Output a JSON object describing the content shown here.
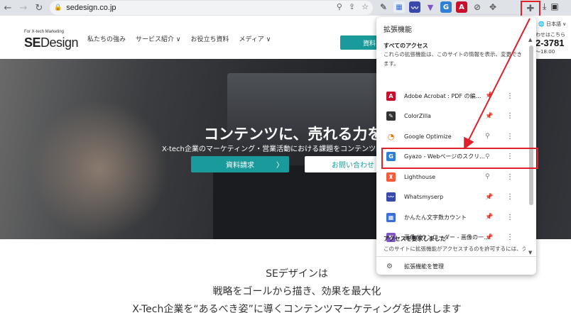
{
  "browser": {
    "url": "sedesign.co.jp",
    "toolbar_icons": [
      "eyedropper-icon",
      "ext-icon",
      "chart-icon",
      "ext-icon",
      "gyazo-icon",
      "acrobat-icon",
      "compass-icon",
      "move-icon"
    ]
  },
  "site": {
    "logo_small": "For X-tech Marketing",
    "logo_bold": "SE",
    "logo_thin": "Design",
    "nav": [
      "私たちの強み",
      "サービス紹介 ∨",
      "お役立ち資料",
      "メディア ∨"
    ],
    "cta": "資料",
    "lang": "🌐 日本語 ∨",
    "contact": "わせはこちら",
    "phone": "2-3781",
    "hours": "～18:00"
  },
  "hero": {
    "title": "コンテンツに、売れる力を",
    "subtitle": "X-tech企業のマーケティング・営業活動における課題をコンテンツ",
    "btn_primary": "資料請求",
    "btn_secondary": "お問い合わせ"
  },
  "intro": {
    "line1": "SEデザインは",
    "line2": "戦略をゴールから描き、効果を最大化",
    "line3": "X-Tech企業を“あるべき姿”に導くコンテンツマーケティングを提供します"
  },
  "popup": {
    "title": "拡張機能",
    "section_access": "すべてのアクセス",
    "access_desc": "これらの拡張機能は、このサイトの情報を表示、変更でき ます。",
    "extensions": [
      {
        "name": "Adobe Acrobat : PDF の編...",
        "color": "#c8102e",
        "glyph": "A",
        "pinned": true
      },
      {
        "name": "ColorZilla",
        "color": "#333333",
        "glyph": "✎",
        "pinned": true
      },
      {
        "name": "Google Optimize",
        "color": "#ffffff",
        "glyph": "◔",
        "pinned": false
      },
      {
        "name": "Gyazo - Webページのスクリ...",
        "color": "#2f7fd6",
        "glyph": "G",
        "pinned": false
      },
      {
        "name": "Lighthouse",
        "color": "#f25c3b",
        "glyph": "♜",
        "pinned": false
      },
      {
        "name": "Whatsmyserp",
        "color": "#3949ab",
        "glyph": "〰",
        "pinned": true
      },
      {
        "name": "かんたん文字数カウント",
        "color": "#3b6fd8",
        "glyph": "▦",
        "pinned": true
      },
      {
        "name": "画像ダウンローダー - 画像の一...",
        "color": "#7e57c2",
        "glyph": "▼",
        "pinned": true
      }
    ],
    "section_request": "アクセスを要求しました",
    "request_desc": "このサイトに拡張機能がアクセスするのを許可するには、ク",
    "manage_label": "拡張機能を管理"
  }
}
